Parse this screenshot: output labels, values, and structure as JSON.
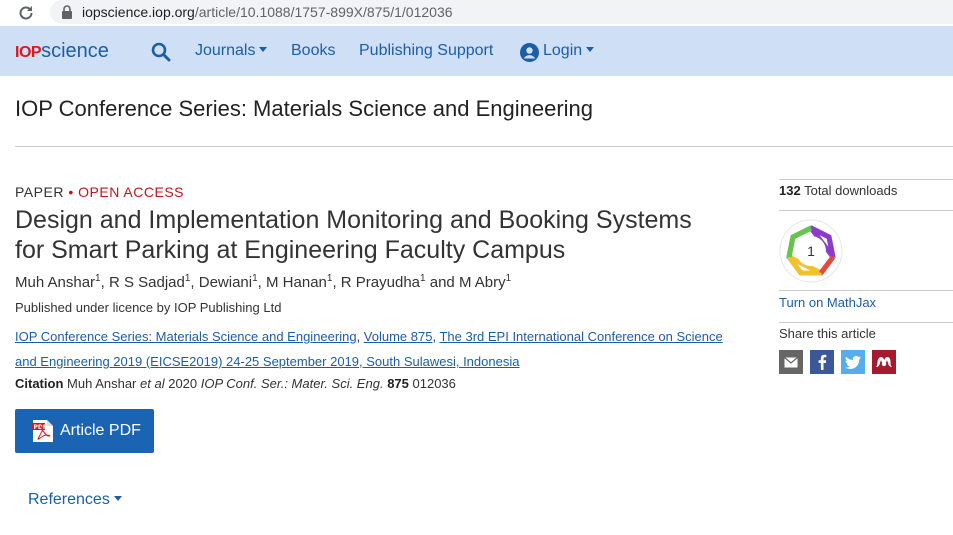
{
  "browser": {
    "url_domain": "iopscience.iop.org",
    "url_path": "/article/10.1088/1757-899X/875/1/012036"
  },
  "nav": {
    "logo_iop": "IOP",
    "logo_science": "science",
    "journals": "Journals",
    "books": "Books",
    "publishing_support": "Publishing Support",
    "login": "Login"
  },
  "journal_title": "IOP Conference Series: Materials Science and Engineering",
  "article": {
    "type": "PAPER",
    "separator": "•",
    "access": "OPEN ACCESS",
    "title": "Design and Implementation Monitoring and Booking Systems for Smart Parking at Engineering Faculty Campus",
    "authors": [
      {
        "name": "Muh Anshar",
        "sup": "1",
        "sep": ", "
      },
      {
        "name": "R S Sadjad",
        "sup": "1",
        "sep": ", "
      },
      {
        "name": "Dewiani",
        "sup": "1",
        "sep": ", "
      },
      {
        "name": "M Hanan",
        "sup": "1",
        "sep": ", "
      },
      {
        "name": "R Prayudha",
        "sup": "1",
        "sep": " and "
      },
      {
        "name": "M Abry",
        "sup": "1",
        "sep": ""
      }
    ],
    "licence": "Published under licence by IOP Publishing Ltd",
    "journal_link": "IOP Conference Series: Materials Science and Engineering",
    "volume_link": "Volume 875",
    "conference_link": "The 3rd EPI International Conference on Science and Engineering 2019 (EICSE2019) 24-25 September 2019, South Sulawesi, Indonesia",
    "citation_label": "Citation",
    "citation_authors": "Muh Anshar",
    "citation_etal": "et al",
    "citation_year": "2020",
    "citation_journal": "IOP Conf. Ser.: Mater. Sci. Eng.",
    "citation_volume": "875",
    "citation_number": "012036",
    "pdf_button": "Article PDF",
    "references": "References"
  },
  "sidebar": {
    "downloads_count": "132",
    "downloads_label": "Total downloads",
    "altmetric_score": "1",
    "mathjax": "Turn on MathJax",
    "share_title": "Share this article",
    "share_buttons": [
      {
        "name": "email",
        "color": "#666666"
      },
      {
        "name": "facebook",
        "color": "#3b5998"
      },
      {
        "name": "twitter",
        "color": "#55acee"
      },
      {
        "name": "mendeley",
        "color": "#a6192e"
      }
    ]
  },
  "colors": {
    "brand_blue": "#1b5ea8",
    "nav_bg": "#cfdff5",
    "open_access_red": "#c0161e",
    "pdf_button": "#1b64b3"
  }
}
